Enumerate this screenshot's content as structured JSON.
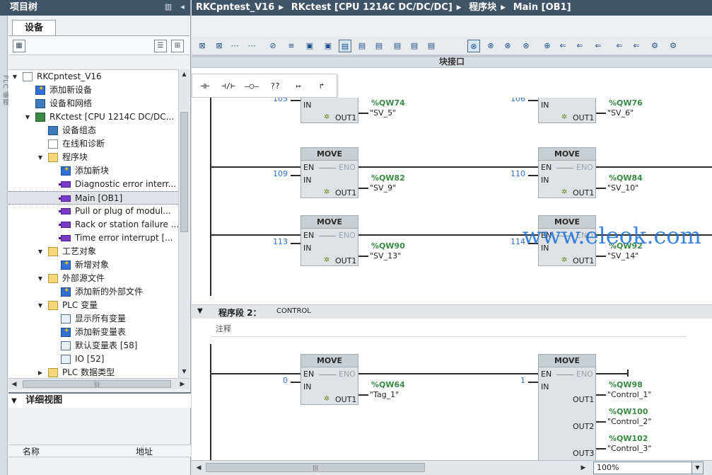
{
  "left_panel": {
    "title": "项目树",
    "tab": "设备",
    "side_strip": "PLC 编程",
    "tree": [
      {
        "label": "RKCpntest_V16",
        "level": 0,
        "expanded": true,
        "icon": "project-icon"
      },
      {
        "label": "添加新设备",
        "level": 1,
        "icon": "add-device-icon"
      },
      {
        "label": "设备和网络",
        "level": 1,
        "icon": "network-icon"
      },
      {
        "label": "RKctest [CPU 1214C DC/DC...",
        "level": 1,
        "expanded": true,
        "icon": "cpu-icon"
      },
      {
        "label": "设备组态",
        "level": 2,
        "icon": "device-config-icon"
      },
      {
        "label": "在线和诊断",
        "level": 2,
        "icon": "online-diagnostics-icon"
      },
      {
        "label": "程序块",
        "level": 2,
        "expanded": true,
        "icon": "folder-icon"
      },
      {
        "label": "添加新块",
        "level": 3,
        "icon": "add-block-icon"
      },
      {
        "label": "Diagnostic error interr...",
        "level": 3,
        "icon": "block-icon"
      },
      {
        "label": "Main [OB1]",
        "level": 3,
        "icon": "block-icon",
        "selected": true
      },
      {
        "label": "Pull or plug of modul...",
        "level": 3,
        "icon": "block-icon"
      },
      {
        "label": "Rack or station failure ...",
        "level": 3,
        "icon": "block-icon"
      },
      {
        "label": "Time error interrupt [...",
        "level": 3,
        "icon": "block-icon"
      },
      {
        "label": "工艺对象",
        "level": 2,
        "expanded": true,
        "icon": "folder-icon"
      },
      {
        "label": "新增对象",
        "level": 3,
        "icon": "add-object-icon"
      },
      {
        "label": "外部源文件",
        "level": 2,
        "expanded": true,
        "icon": "folder-icon"
      },
      {
        "label": "添加新的外部文件",
        "level": 3,
        "icon": "add-file-icon"
      },
      {
        "label": "PLC 变量",
        "level": 2,
        "expanded": true,
        "icon": "folder-icon"
      },
      {
        "label": "显示所有变量",
        "level": 3,
        "icon": "tag-table-icon"
      },
      {
        "label": "添加新变量表",
        "level": 3,
        "icon": "add-tag-table-icon"
      },
      {
        "label": "默认变量表 [58]",
        "level": 3,
        "icon": "tag-table-icon"
      },
      {
        "label": "IO [52]",
        "level": 3,
        "icon": "tag-table-icon"
      },
      {
        "label": "PLC 数据类型",
        "level": 2,
        "expanded": false,
        "icon": "folder-icon"
      }
    ],
    "detail_view": {
      "title": "详细视图",
      "columns": [
        "名称",
        "地址"
      ]
    }
  },
  "editor": {
    "breadcrumb": [
      "RKCpntest_V16",
      "RKctest [CPU 1214C DC/DC/DC]",
      "程序块",
      "Main [OB1]"
    ],
    "block_interface_label": "块接口",
    "ladder_toolbar": [
      "⊣⊢",
      "⊣/⊢",
      "–○–",
      "??",
      "↦",
      "↱"
    ],
    "segment2": {
      "title": "程序段 2：",
      "comment": "CONTROL",
      "comment_placeholder": "注释"
    },
    "zoom": "100%",
    "move_label": "MOVE",
    "pins": {
      "en": "EN",
      "eno": "ENO",
      "in": "IN",
      "out1": "OUT1",
      "out2": "OUT2",
      "out3": "OUT3"
    },
    "rows": [
      {
        "in_left": "105",
        "addr_left": "%QW74",
        "sym_left": "\"SV_5\"",
        "in_right": "106",
        "addr_right": "%QW76",
        "sym_right": "\"SV_6\""
      },
      {
        "in_left": "109",
        "addr_left": "%QW82",
        "sym_left": "\"SV_9\"",
        "in_right": "110",
        "addr_right": "%QW84",
        "sym_right": "\"SV_10\""
      },
      {
        "in_left": "113",
        "addr_left": "%QW90",
        "sym_left": "\"SV_13\"",
        "in_right": "114",
        "addr_right": "%QW92",
        "sym_right": "\"SV_14\""
      }
    ],
    "seg2_row": {
      "in_left": "0",
      "addr_left": "%QW64",
      "sym_left": "\"Tag_1\"",
      "in_right": "1",
      "outputs": [
        {
          "addr": "%QW98",
          "sym": "\"Control_1\""
        },
        {
          "addr": "%QW100",
          "sym": "\"Control_2\""
        },
        {
          "addr": "%QW102",
          "sym": "\"Control_3\""
        }
      ]
    }
  },
  "watermark": "www.eleok.com"
}
